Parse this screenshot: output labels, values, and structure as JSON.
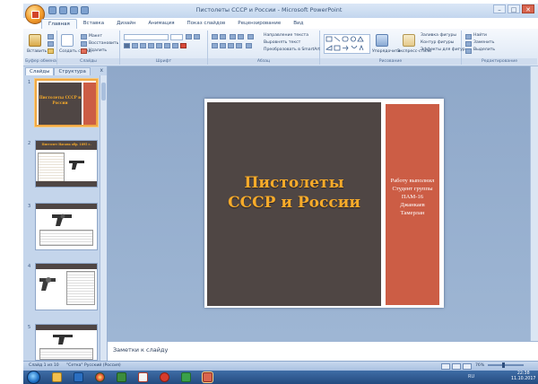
{
  "window": {
    "title": "Пистолеты СССР и России - Microsoft PowerPoint",
    "controls": [
      "–",
      "□",
      "✕"
    ]
  },
  "ribbon": {
    "tabs": [
      "Главная",
      "Вставка",
      "Дизайн",
      "Анимация",
      "Показ слайдов",
      "Рецензирование",
      "Вид"
    ],
    "active_tab": "Главная",
    "clipboard": {
      "paste": "Вставить",
      "cut": "Вырезать",
      "copy": "Копировать",
      "painter": "Формат по образцу",
      "label": "Буфер обмена"
    },
    "slides": {
      "create": "Создать слайд",
      "layout": "Макет",
      "reset": "Восстановить",
      "delete": "Удалить",
      "label": "Слайды"
    },
    "font": {
      "label": "Шрифт"
    },
    "paragraph": {
      "direction": "Направление текста",
      "align": "Выровнять текст",
      "smartart": "Преобразовать в SmartArt",
      "label": "Абзац"
    },
    "drawing": {
      "arrange": "Упорядочить",
      "styles": "Экспресс-стили",
      "fill": "Заливка фигуры",
      "outline": "Контур фигуры",
      "effects": "Эффекты для фигур",
      "label": "Рисование"
    },
    "editing": {
      "find": "Найти",
      "replace": "Заменить",
      "select": "Выделить",
      "label": "Редактирование"
    }
  },
  "left_panel": {
    "tabs": [
      "Слайды",
      "Структура"
    ],
    "active_tab": "Слайды",
    "close": "x",
    "thumbnails": [
      {
        "num": "1",
        "title": "Пистолеты СССР и России"
      },
      {
        "num": "2",
        "title": "Пистолет Нагана обр. 1895 г."
      },
      {
        "num": "3"
      },
      {
        "num": "4"
      },
      {
        "num": "5"
      }
    ]
  },
  "slide": {
    "title": "Пистолеты СССР и России",
    "author_lines": [
      "Работу выполнил",
      "Студент группы",
      "ПАМ-16",
      "Джанкаев",
      "Тамерлан"
    ]
  },
  "notes": {
    "placeholder": "Заметки к слайду"
  },
  "status": {
    "slide_info": "Слайд 1 из 10",
    "theme": "\"Сетка\"",
    "language": "Русский (Россия)",
    "zoom": "76%"
  },
  "taskbar": {
    "lang": "RU",
    "time": "22:38",
    "date": "11.10.2017"
  },
  "colors": {
    "slide_dark": "#4f4644",
    "slide_accent": "#cc5d45",
    "title_text": "#f7ab2a",
    "ribbon_bg": "#dbe6f4",
    "taskbar": "#244b80"
  }
}
